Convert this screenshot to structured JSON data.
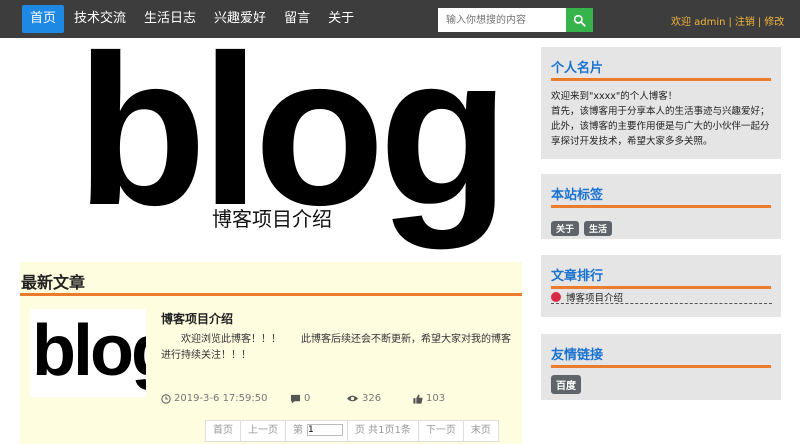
{
  "nav": {
    "items": [
      {
        "label": "首页",
        "active": true
      },
      {
        "label": "技术交流",
        "active": false
      },
      {
        "label": "生活日志",
        "active": false
      },
      {
        "label": "兴趣爱好",
        "active": false
      },
      {
        "label": "留言",
        "active": false
      },
      {
        "label": "关于",
        "active": false
      }
    ],
    "search_placeholder": "输入你想搜的内容",
    "search_icon": "search-icon",
    "welcome": "欢迎 admin",
    "logout": "注销",
    "edit": "修改"
  },
  "hero": {
    "logo_text": "blog",
    "caption": "博客项目介绍"
  },
  "latest": {
    "title": "最新文章",
    "article": {
      "thumb_text": "blog",
      "title": "博客项目介绍",
      "summary": "欢迎浏览此博客！！！　　此博客后续还会不断更新，希望大家对我的博客进行持续关注！！！",
      "date": "2019-3-6 17:59:50",
      "comments": "0",
      "views": "326",
      "likes": "103"
    },
    "pager": {
      "first": "首页",
      "prev": "上一页",
      "page_label": "第",
      "page_value": "1",
      "page_info": "页 共1页1条",
      "next": "下一页",
      "last": "末页"
    }
  },
  "sidebar": {
    "profile": {
      "title": "个人名片",
      "line1": "欢迎来到\"xxxx\"的个人博客！",
      "line2": "首先，该博客用于分享本人的生活事迹与兴趣爱好；此外，该博客的主要作用便是与广大的小伙伴一起分享探讨开发技术，希望大家多多关照。"
    },
    "tags": {
      "title": "本站标签",
      "items": [
        "关于",
        "生活"
      ]
    },
    "ranking": {
      "title": "文章排行",
      "items": [
        "博客项目介绍"
      ]
    },
    "links": {
      "title": "友情链接",
      "items": [
        "百度"
      ]
    }
  },
  "colors": {
    "nav_bg": "#3d3d3d",
    "nav_active": "#1e88e5",
    "accent_line": "#ea7c2b",
    "panel_title": "#1a73d1",
    "search_btn": "#36b34a",
    "user_text": "#f3b33d"
  }
}
